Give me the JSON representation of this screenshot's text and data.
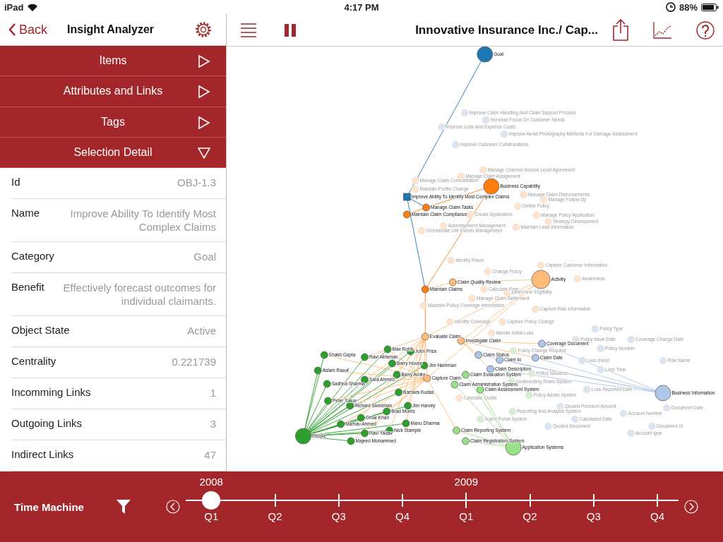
{
  "status_bar": {
    "device": "iPad",
    "time": "4:17 PM",
    "battery": "88%"
  },
  "sidebar": {
    "back": "Back",
    "title": "Insight Analyzer",
    "sections": [
      {
        "label": "Items",
        "expanded": false
      },
      {
        "label": "Attributes and Links",
        "expanded": false
      },
      {
        "label": "Tags",
        "expanded": false
      },
      {
        "label": "Selection Detail",
        "expanded": true
      }
    ],
    "details": [
      {
        "label": "Id",
        "value": "OBJ-1.3"
      },
      {
        "label": "Name",
        "value": "Improve Ability To Identify Most Complex Claims"
      },
      {
        "label": "Category",
        "value": "Goal"
      },
      {
        "label": "Benefit",
        "value": "Effectively forecast outcomes for individual claimants."
      },
      {
        "label": "Object State",
        "value": "Active"
      },
      {
        "label": "Centrality",
        "value": "0.221739"
      },
      {
        "label": "Incomming Links",
        "value": "1"
      },
      {
        "label": "Outgoing Links",
        "value": "3"
      },
      {
        "label": "Indirect Links",
        "value": "47"
      }
    ]
  },
  "toolbar": {
    "title": "Innovative Insurance Inc./ Cap..."
  },
  "graph": {
    "nodes": [
      {
        "label": "Goal",
        "color": "#1f77b4",
        "dimmed": false,
        "selected": false
      },
      {
        "label": "Improve Claim Handling And Claim Support Process",
        "color": "#dbe5f1",
        "dimmed": true,
        "selected": false
      },
      {
        "label": "Increase Focus On Customer Needs",
        "color": "#dbe5f1",
        "dimmed": true,
        "selected": false
      },
      {
        "label": "Improve Loss And Expense Costs",
        "color": "#dbe5f1",
        "dimmed": true,
        "selected": false
      },
      {
        "label": "Improve Aerial Photography Methods For Damage Assessment",
        "color": "#dbe5f1",
        "dimmed": true,
        "selected": false
      },
      {
        "label": "Improve Customer Collaborations",
        "color": "#dbe5f1",
        "dimmed": true,
        "selected": false
      },
      {
        "label": "Manage Channel Service Level Agreement",
        "color": "#fde3cc",
        "dimmed": true,
        "selected": false
      },
      {
        "label": "Manage Claim Assignment",
        "color": "#fde3cc",
        "dimmed": true,
        "selected": false
      },
      {
        "label": "Manage Claim Consolidation",
        "color": "#fde3cc",
        "dimmed": true,
        "selected": false
      },
      {
        "label": "Business Capability",
        "color": "#ff7f0e",
        "dimmed": false,
        "selected": false
      },
      {
        "label": "Maintain Profile Change",
        "color": "#fde3cc",
        "dimmed": true,
        "selected": false
      },
      {
        "label": "Improve Ability To Identify Most Complex Claims",
        "color": "#1f77b4",
        "dimmed": false,
        "selected": true
      },
      {
        "label": "Manage Claim Disbursements",
        "color": "#fde3cc",
        "dimmed": true,
        "selected": false
      },
      {
        "label": "Manage Follow Up",
        "color": "#fde3cc",
        "dimmed": true,
        "selected": false
      },
      {
        "label": "Manage Claim Tasks",
        "color": "#ff7f0e",
        "dimmed": false,
        "selected": false
      },
      {
        "label": "Define Policy",
        "color": "#fde3cc",
        "dimmed": true,
        "selected": false
      },
      {
        "label": "Maintain Claim Compliance",
        "color": "#ff7f0e",
        "dimmed": false,
        "selected": false
      },
      {
        "label": "Create Application",
        "color": "#fde3cc",
        "dimmed": true,
        "selected": false
      },
      {
        "label": "Manage Policy Application",
        "color": "#fde3cc",
        "dimmed": true,
        "selected": false
      },
      {
        "label": "Strategy Development",
        "color": "#fde3cc",
        "dimmed": true,
        "selected": false
      },
      {
        "label": "Advertisement Management",
        "color": "#fde3cc",
        "dimmed": true,
        "selected": false
      },
      {
        "label": "Maintain Lead Information",
        "color": "#fde3cc",
        "dimmed": true,
        "selected": false
      },
      {
        "label": "Orchestrate Life Events Management",
        "color": "#fde3cc",
        "dimmed": true,
        "selected": false
      },
      {
        "label": "Identify Fraud",
        "color": "#fde3cc",
        "dimmed": true,
        "selected": false
      },
      {
        "label": "Capture Customer Information",
        "color": "#fde3cc",
        "dimmed": true,
        "selected": false
      },
      {
        "label": "Change Policy",
        "color": "#fde3cc",
        "dimmed": true,
        "selected": false
      },
      {
        "label": "Claim Quality Review",
        "color": "#ffbb78",
        "dimmed": false,
        "selected": false
      },
      {
        "label": "Activity",
        "color": "#ffbb78",
        "dimmed": false,
        "selected": false
      },
      {
        "label": "Awareness",
        "color": "#fde3cc",
        "dimmed": true,
        "selected": false
      },
      {
        "label": "Maintain Claims",
        "color": "#ff7f0e",
        "dimmed": false,
        "selected": false
      },
      {
        "label": "Calculate Rate",
        "color": "#fde3cc",
        "dimmed": true,
        "selected": false
      },
      {
        "label": "Determine Eligibility",
        "color": "#fde3cc",
        "dimmed": true,
        "selected": false
      },
      {
        "label": "Manage Claim Settlement",
        "color": "#fde3cc",
        "dimmed": true,
        "selected": false
      },
      {
        "label": "Maintain Policy Coverage Information",
        "color": "#fde3cc",
        "dimmed": true,
        "selected": false
      },
      {
        "label": "Capture Risk Information",
        "color": "#fde3cc",
        "dimmed": true,
        "selected": false
      },
      {
        "label": "Identify Coverage",
        "color": "#fde3cc",
        "dimmed": true,
        "selected": false
      },
      {
        "label": "Capture Policy Change",
        "color": "#fde3cc",
        "dimmed": true,
        "selected": false
      },
      {
        "label": "Policy Type",
        "color": "#dbe5f1",
        "dimmed": true,
        "selected": false
      },
      {
        "label": "Handle Initial Loss",
        "color": "#fde3cc",
        "dimmed": true,
        "selected": false
      },
      {
        "label": "Evaluate Claim",
        "color": "#ffbb78",
        "dimmed": false,
        "selected": false
      },
      {
        "label": "Investigate Claim",
        "color": "#ffbb78",
        "dimmed": false,
        "selected": false
      },
      {
        "label": "Coverage Document",
        "color": "#aec7e8",
        "dimmed": false,
        "selected": false
      },
      {
        "label": "Policy Issue Date",
        "color": "#dbe5f1",
        "dimmed": true,
        "selected": false
      },
      {
        "label": "Coverage Change Date",
        "color": "#dbe5f1",
        "dimmed": true,
        "selected": false
      },
      {
        "label": "Max Rohit",
        "color": "#2ca02c",
        "dimmed": false,
        "selected": false
      },
      {
        "label": "John Price",
        "color": "#2ca02c",
        "dimmed": false,
        "selected": false
      },
      {
        "label": "Policy Change Request",
        "color": "#d8eed3",
        "dimmed": true,
        "selected": false
      },
      {
        "label": "Policy Number",
        "color": "#dbe5f1",
        "dimmed": true,
        "selected": false
      },
      {
        "label": "Shakti Gupta",
        "color": "#2ca02c",
        "dimmed": false,
        "selected": false
      },
      {
        "label": "Ravi Abhenan",
        "color": "#2ca02c",
        "dimmed": false,
        "selected": false
      },
      {
        "label": "Barry House",
        "color": "#2ca02c",
        "dimmed": false,
        "selected": false
      },
      {
        "label": "Jim Harriman",
        "color": "#2ca02c",
        "dimmed": false,
        "selected": false
      },
      {
        "label": "Claim Status",
        "color": "#aec7e8",
        "dimmed": false,
        "selected": false
      },
      {
        "label": "Claim Id",
        "color": "#aec7e8",
        "dimmed": false,
        "selected": false
      },
      {
        "label": "Claim Date",
        "color": "#aec7e8",
        "dimmed": false,
        "selected": false
      },
      {
        "label": "Loss Event",
        "color": "#dbe5f1",
        "dimmed": true,
        "selected": false
      },
      {
        "label": "Risk Name",
        "color": "#dbe5f1",
        "dimmed": true,
        "selected": false
      },
      {
        "label": "Aslam Raouf",
        "color": "#2ca02c",
        "dimmed": false,
        "selected": false
      },
      {
        "label": "Barry Andre",
        "color": "#2ca02c",
        "dimmed": false,
        "selected": false
      },
      {
        "label": "Claim Description",
        "color": "#aec7e8",
        "dimmed": false,
        "selected": false
      },
      {
        "label": "Claim Evaluation System",
        "color": "#98df8a",
        "dimmed": false,
        "selected": false
      },
      {
        "label": "Policy Issuance",
        "color": "#d8eed3",
        "dimmed": true,
        "selected": false
      },
      {
        "label": "Loss Time",
        "color": "#dbe5f1",
        "dimmed": true,
        "selected": false
      },
      {
        "label": "Sadhna Sharma",
        "color": "#2ca02c",
        "dimmed": false,
        "selected": false
      },
      {
        "label": "Sara Ahmed",
        "color": "#2ca02c",
        "dimmed": false,
        "selected": false
      },
      {
        "label": "Capture Claim",
        "color": "#ffbb78",
        "dimmed": false,
        "selected": false
      },
      {
        "label": "Claim Administration System",
        "color": "#98df8a",
        "dimmed": false,
        "selected": false
      },
      {
        "label": "Underwriting Rules System",
        "color": "#d8eed3",
        "dimmed": true,
        "selected": false
      },
      {
        "label": "Peter Sakar",
        "color": "#2ca02c",
        "dimmed": false,
        "selected": false
      },
      {
        "label": "Barbara Kudas",
        "color": "#2ca02c",
        "dimmed": false,
        "selected": false
      },
      {
        "label": "Calculate Quote",
        "color": "#fde3cc",
        "dimmed": true,
        "selected": false
      },
      {
        "label": "Claim Assessment System",
        "color": "#98df8a",
        "dimmed": false,
        "selected": false
      },
      {
        "label": "Policy Admin System",
        "color": "#d8eed3",
        "dimmed": true,
        "selected": false
      },
      {
        "label": "Loss Reported Date",
        "color": "#dbe5f1",
        "dimmed": true,
        "selected": false
      },
      {
        "label": "Business Information",
        "color": "#aec7e8",
        "dimmed": false,
        "selected": false
      },
      {
        "label": "Richard Swedman",
        "color": "#2ca02c",
        "dimmed": false,
        "selected": false
      },
      {
        "label": "Jim Harvey",
        "color": "#2ca02c",
        "dimmed": false,
        "selected": false
      },
      {
        "label": "Quoted Premium Amount",
        "color": "#dbe5f1",
        "dimmed": true,
        "selected": false
      },
      {
        "label": "Document Date",
        "color": "#dbe5f1",
        "dimmed": true,
        "selected": false
      },
      {
        "label": "Brad Morris",
        "color": "#2ca02c",
        "dimmed": false,
        "selected": false
      },
      {
        "label": "Reporting And Analysis System",
        "color": "#d8eed3",
        "dimmed": true,
        "selected": false
      },
      {
        "label": "Account Number",
        "color": "#dbe5f1",
        "dimmed": true,
        "selected": false
      },
      {
        "label": "Omar Khan",
        "color": "#2ca02c",
        "dimmed": false,
        "selected": false
      },
      {
        "label": "Agent Portal System",
        "color": "#d8eed3",
        "dimmed": true,
        "selected": false
      },
      {
        "label": "Calculated Date",
        "color": "#dbe5f1",
        "dimmed": true,
        "selected": false
      },
      {
        "label": "Mamdu Ahmed",
        "color": "#2ca02c",
        "dimmed": false,
        "selected": false
      },
      {
        "label": "Manu Dharma",
        "color": "#2ca02c",
        "dimmed": false,
        "selected": false
      },
      {
        "label": "Quoted Document",
        "color": "#dbe5f1",
        "dimmed": true,
        "selected": false
      },
      {
        "label": "Document Id",
        "color": "#dbe5f1",
        "dimmed": true,
        "selected": false
      },
      {
        "label": "People",
        "color": "#2ca02c",
        "dimmed": false,
        "selected": false
      },
      {
        "label": "Ravi Yadav",
        "color": "#2ca02c",
        "dimmed": false,
        "selected": false
      },
      {
        "label": "Nick Stample",
        "color": "#2ca02c",
        "dimmed": false,
        "selected": false
      },
      {
        "label": "Claim Reporting System",
        "color": "#98df8a",
        "dimmed": false,
        "selected": false
      },
      {
        "label": "Account type",
        "color": "#dbe5f1",
        "dimmed": true,
        "selected": false
      },
      {
        "label": "Majeed Mohammed",
        "color": "#2ca02c",
        "dimmed": false,
        "selected": false
      },
      {
        "label": "Claim Registration System",
        "color": "#98df8a",
        "dimmed": false,
        "selected": false
      },
      {
        "label": "Application Systems",
        "color": "#98df8a",
        "dimmed": false,
        "selected": false
      }
    ]
  },
  "time_machine": {
    "label": "Time Machine",
    "years": [
      {
        "label": "2008"
      },
      {
        "label": "2009"
      }
    ],
    "quarters": [
      {
        "label": "Q1"
      },
      {
        "label": "Q2"
      },
      {
        "label": "Q3"
      },
      {
        "label": "Q4"
      },
      {
        "label": "Q1"
      },
      {
        "label": "Q2"
      },
      {
        "label": "Q3"
      },
      {
        "label": "Q4"
      }
    ],
    "level": 0
  }
}
